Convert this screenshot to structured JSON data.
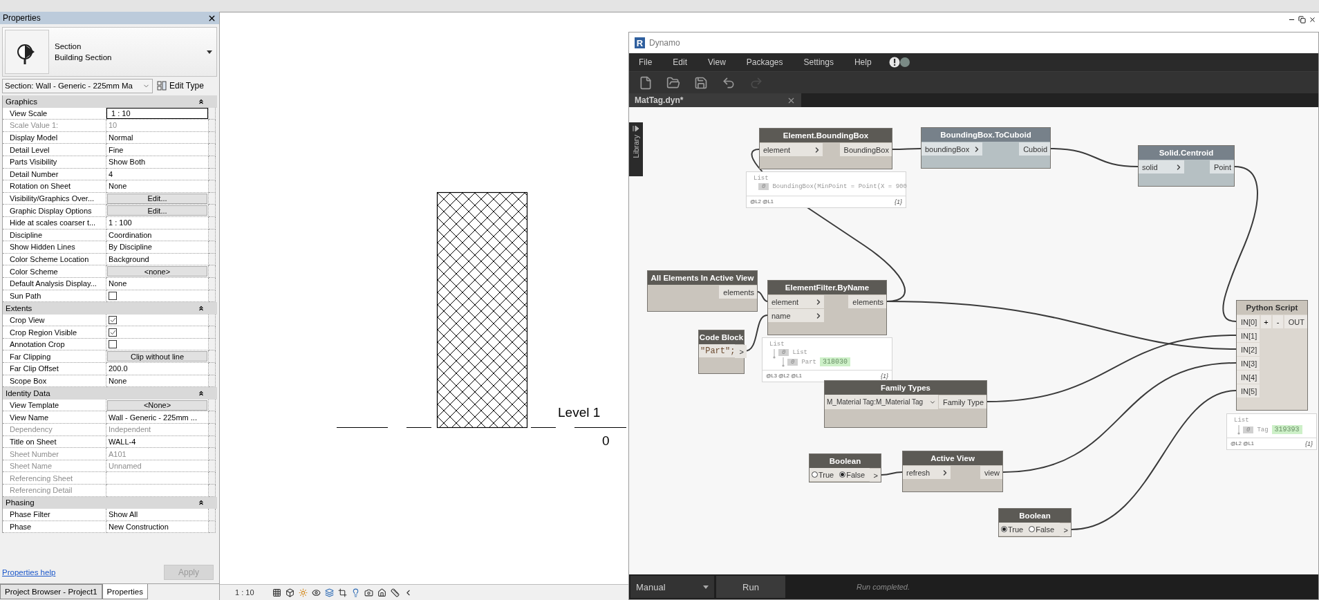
{
  "properties": {
    "title": "Properties",
    "header": {
      "line1": "Section",
      "line2": "Building Section"
    },
    "type_selector": "Section: Wall - Generic - 225mm Ma",
    "edit_type": "Edit Type",
    "groups": [
      {
        "name": "Graphics",
        "expanded": true,
        "rows": [
          {
            "label": "View Scale",
            "value": "1 : 10",
            "kind": "input",
            "disabled": false
          },
          {
            "label": "Scale Value    1:",
            "value": "10",
            "kind": "text",
            "disabled": true
          },
          {
            "label": "Display Model",
            "value": "Normal",
            "kind": "text",
            "disabled": false
          },
          {
            "label": "Detail Level",
            "value": "Fine",
            "kind": "text",
            "disabled": false
          },
          {
            "label": "Parts Visibility",
            "value": "Show Both",
            "kind": "text",
            "disabled": false
          },
          {
            "label": "Detail Number",
            "value": "4",
            "kind": "text",
            "disabled": false
          },
          {
            "label": "Rotation on Sheet",
            "value": "None",
            "kind": "text",
            "disabled": false
          },
          {
            "label": "Visibility/Graphics Over...",
            "value": "Edit...",
            "kind": "button",
            "disabled": false
          },
          {
            "label": "Graphic Display Options",
            "value": "Edit...",
            "kind": "button",
            "disabled": false
          },
          {
            "label": "Hide at scales coarser t...",
            "value": "1 : 100",
            "kind": "text",
            "disabled": false
          },
          {
            "label": "Discipline",
            "value": "Coordination",
            "kind": "text",
            "disabled": false
          },
          {
            "label": "Show Hidden Lines",
            "value": "By Discipline",
            "kind": "text",
            "disabled": false
          },
          {
            "label": "Color Scheme Location",
            "value": "Background",
            "kind": "text",
            "disabled": false
          },
          {
            "label": "Color Scheme",
            "value": "<none>",
            "kind": "button",
            "disabled": false
          },
          {
            "label": "Default Analysis Display...",
            "value": "None",
            "kind": "text",
            "disabled": false
          },
          {
            "label": "Sun Path",
            "kind": "checkbox",
            "checked": false,
            "disabled": false
          }
        ]
      },
      {
        "name": "Extents",
        "expanded": true,
        "rows": [
          {
            "label": "Crop View",
            "kind": "checkbox",
            "checked": true,
            "disabled": false
          },
          {
            "label": "Crop Region Visible",
            "kind": "checkbox",
            "checked": true,
            "disabled": false
          },
          {
            "label": "Annotation Crop",
            "kind": "checkbox",
            "checked": false,
            "disabled": false
          },
          {
            "label": "Far Clipping",
            "value": "Clip without line",
            "kind": "button",
            "disabled": false
          },
          {
            "label": "Far Clip Offset",
            "value": "200.0",
            "kind": "text",
            "disabled": false
          },
          {
            "label": "Scope Box",
            "value": "None",
            "kind": "text",
            "disabled": false
          }
        ]
      },
      {
        "name": "Identity Data",
        "expanded": true,
        "rows": [
          {
            "label": "View Template",
            "value": "<None>",
            "kind": "button",
            "disabled": false
          },
          {
            "label": "View Name",
            "value": "Wall - Generic - 225mm ...",
            "kind": "text",
            "disabled": false
          },
          {
            "label": "Dependency",
            "value": "Independent",
            "kind": "text",
            "disabled": true
          },
          {
            "label": "Title on Sheet",
            "value": "WALL-4",
            "kind": "text",
            "disabled": false
          },
          {
            "label": "Sheet Number",
            "value": "A101",
            "kind": "text",
            "disabled": true
          },
          {
            "label": "Sheet Name",
            "value": "Unnamed",
            "kind": "text",
            "disabled": true
          },
          {
            "label": "Referencing Sheet",
            "kind": "text",
            "disabled": true
          },
          {
            "label": "Referencing Detail",
            "kind": "text",
            "disabled": true
          }
        ]
      },
      {
        "name": "Phasing",
        "expanded": true,
        "rows": [
          {
            "label": "Phase Filter",
            "value": "Show All",
            "kind": "text",
            "disabled": false
          },
          {
            "label": "Phase",
            "value": "New Construction",
            "kind": "text",
            "disabled": false
          }
        ]
      }
    ],
    "help_link": "Properties help",
    "apply": {
      "label": "Apply",
      "disabled": true
    }
  },
  "panel_tabs": [
    {
      "label": "Project Browser - Project1",
      "selected": false
    },
    {
      "label": "Properties",
      "selected": true
    }
  ],
  "view": {
    "level_name": "Level 1",
    "level_elevation": "0",
    "scale": "1 : 10"
  },
  "dynamo": {
    "logo": "R",
    "title": "Dynamo",
    "menu": [
      "File",
      "Edit",
      "View",
      "Packages",
      "Settings",
      "Help"
    ],
    "toolbar": [
      {
        "kind": "new",
        "disabled": false
      },
      {
        "kind": "open",
        "disabled": false
      },
      {
        "kind": "save",
        "disabled": false
      },
      {
        "kind": "undo",
        "disabled": false
      },
      {
        "kind": "redo",
        "disabled": true
      }
    ],
    "tab": "MatTag.dyn*",
    "library": "Library",
    "nodes": [
      {
        "kind": "function",
        "title": "Element.BoundingBox",
        "color": "#5c5a55",
        "inputs": [
          "element"
        ],
        "outputs": [
          "BoundingBox"
        ],
        "preview": {
          "label": "List",
          "children": [
            {
              "index": "0",
              "name": "BoundingBox(MinPoint = Point(X = 900"
            }
          ],
          "levels": "@L2 @L1",
          "count": "{1}"
        }
      },
      {
        "kind": "function",
        "title": "BoundingBox.ToCuboid",
        "color": "#77818a",
        "inputs": [
          "boundingBox"
        ],
        "outputs": [
          "Cuboid"
        ]
      },
      {
        "kind": "function",
        "title": "Solid.Centroid",
        "color": "#77818a",
        "inputs": [
          "solid"
        ],
        "outputs": [
          "Point"
        ]
      },
      {
        "kind": "function",
        "title": "All Elements In Active View",
        "color": "#5c5a55",
        "outputs": [
          "elements"
        ]
      },
      {
        "kind": "function",
        "title": "ElementFilter.ByName",
        "color": "#5c5a55",
        "inputs": [
          "element",
          "name"
        ],
        "outputs": [
          "elements"
        ],
        "preview": {
          "label": "List",
          "children": [
            {
              "index": "0",
              "label": "List",
              "children": [
                {
                  "index": "0",
                  "name": "Part",
                  "value": "318030"
                }
              ]
            }
          ],
          "levels": "@L3 @L2 @L1",
          "count": "{1}"
        }
      },
      {
        "kind": "code",
        "title": "Code Block",
        "color": "#5c5a55",
        "code": "\"Part\";",
        "outputs": [
          ">"
        ]
      },
      {
        "kind": "dropdown",
        "title": "Family Types",
        "color": "#5c5a55",
        "value": "M_Material Tag:M_Material Tag",
        "outputs": [
          "Family Type"
        ]
      },
      {
        "kind": "python",
        "title": "Python Script",
        "color": "#cac4bb",
        "inputs": [
          "IN[0]",
          "IN[1]",
          "IN[2]",
          "IN[3]",
          "IN[4]",
          "IN[5]"
        ],
        "add": "+",
        "remove": "-",
        "outputs": [
          "OUT"
        ],
        "preview": {
          "label": "List",
          "children": [
            {
              "index": "0",
              "name": "Tag",
              "value": "319393"
            }
          ],
          "levels": "@L2 @L1",
          "count": "{1}"
        }
      },
      {
        "kind": "boolean",
        "title": "Boolean",
        "color": "#5c5a55",
        "options": [
          {
            "label": "True",
            "selected": false
          },
          {
            "label": "False",
            "selected": true
          }
        ],
        "outputs": [
          ">"
        ]
      },
      {
        "kind": "function",
        "title": "Active View",
        "color": "#5c5a55",
        "inputs": [
          "refresh"
        ],
        "outputs": [
          "view"
        ]
      },
      {
        "kind": "boolean",
        "title": "Boolean",
        "color": "#5c5a55",
        "options": [
          {
            "label": "True",
            "selected": true
          },
          {
            "label": "False",
            "selected": false
          }
        ],
        "outputs": [
          ">"
        ]
      }
    ],
    "run_mode": "Manual",
    "run_button": "Run",
    "status": "Run completed."
  }
}
